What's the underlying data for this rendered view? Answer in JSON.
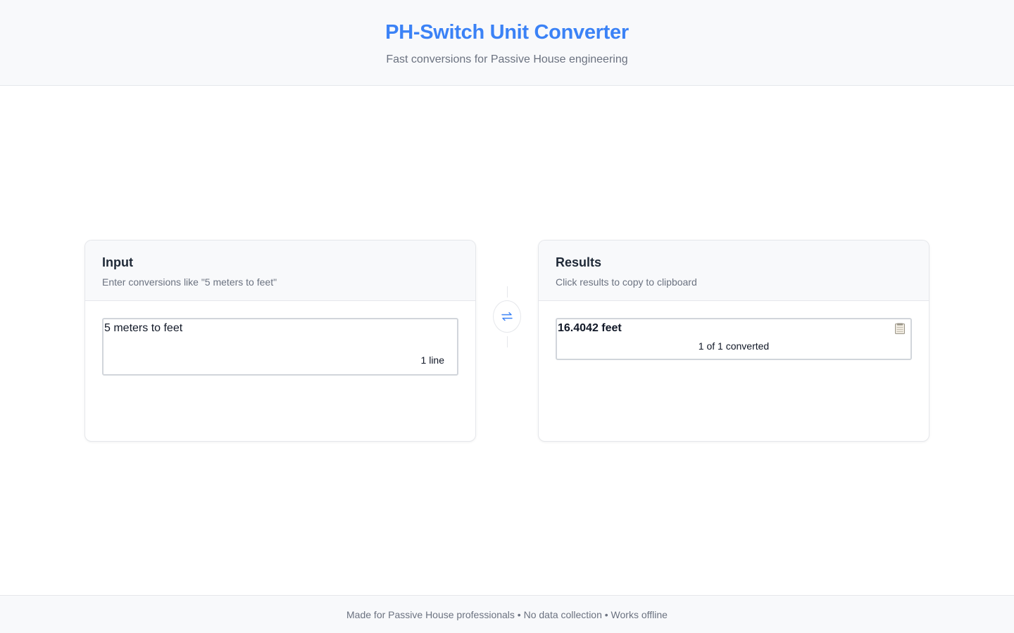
{
  "header": {
    "title": "PH-Switch Unit Converter",
    "subtitle": "Fast conversions for Passive House engineering"
  },
  "input_panel": {
    "title": "Input",
    "description": "Enter conversions like \"5 meters to feet\"",
    "value": "5 meters to feet",
    "line_count": "1 line"
  },
  "results_panel": {
    "title": "Results",
    "description": "Click results to copy to clipboard",
    "result": "16.4042 feet",
    "converted_count": "1 of 1 converted"
  },
  "swap": {
    "icon": "swap-arrows-icon"
  },
  "footer": {
    "text": "Made for Passive House professionals • No data collection • Works offline"
  },
  "colors": {
    "accent": "#3b82f6",
    "muted_text": "#6b7280",
    "border": "#e5e7eb",
    "header_bg": "#f8f9fb"
  }
}
